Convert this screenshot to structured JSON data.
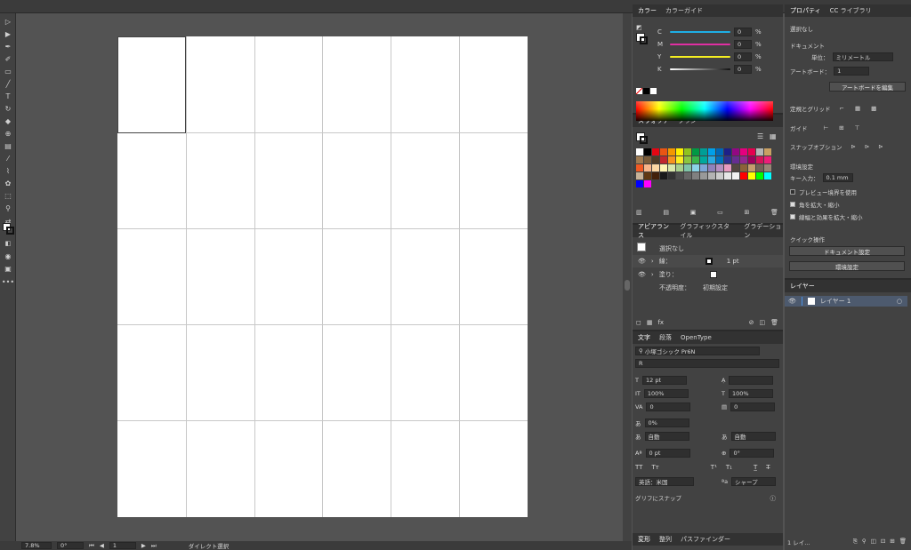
{
  "color_panel": {
    "tabs": [
      "カラー",
      "カラーガイド"
    ],
    "channels": [
      {
        "label": "C",
        "value": "0",
        "unit": "%",
        "color": "#1eaee5"
      },
      {
        "label": "M",
        "value": "0",
        "unit": "%",
        "color": "#e02fa2"
      },
      {
        "label": "Y",
        "value": "0",
        "unit": "%",
        "color": "#f4ee21"
      },
      {
        "label": "K",
        "value": "0",
        "unit": "%",
        "color": "#1b1b1b"
      }
    ]
  },
  "swatches_panel": {
    "tabs": [
      "スウォッチ",
      "ブラシ"
    ],
    "colors": [
      "#ffffff",
      "#000000",
      "#e30613",
      "#e95513",
      "#f39800",
      "#fff100",
      "#8fc31f",
      "#009944",
      "#009e96",
      "#00a0e9",
      "#0068b7",
      "#1d2088",
      "#920783",
      "#e4007f",
      "#e5004f",
      "#b5b5b6",
      "#c9a063",
      "#a07c52",
      "#7a5c3a",
      "#4d3b26",
      "#c1272d",
      "#f7931e",
      "#fcee21",
      "#8cc63f",
      "#39b54a",
      "#00a99d",
      "#29abe2",
      "#0071bc",
      "#2e3192",
      "#662d91",
      "#93278f",
      "#9e005d",
      "#d4145a",
      "#ed1e79",
      "#f15a24",
      "#f7b58a",
      "#fbd7a3",
      "#fff6b3",
      "#d9e8a9",
      "#a7d08c",
      "#7fc4a8",
      "#8bd3e6",
      "#7ea7d8",
      "#8f82bc",
      "#b58fc1",
      "#e89ac0",
      "#534741",
      "#8c6239",
      "#c69c6d",
      "#736357",
      "#998675",
      "#c7b299",
      "#603813",
      "#42210b",
      "#1a1a1a",
      "#333333",
      "#4d4d4d",
      "#666666",
      "#808080",
      "#999999",
      "#b3b3b3",
      "#cccccc",
      "#e6e6e6",
      "#f2f2f2",
      "#ff0000",
      "#ffff00",
      "#00ff00",
      "#00ffff",
      "#0000ff",
      "#ff00ff"
    ]
  },
  "appearance_panel": {
    "tabs": [
      "アピアランス",
      "グラフィックスタイル",
      "グラデーション"
    ],
    "title": "選択なし",
    "stroke_label": "線：",
    "stroke_value": "1 pt",
    "fill_label": "塗り：",
    "opacity_label": "不透明度：",
    "opacity_value": "初期設定"
  },
  "character_panel": {
    "tabs": [
      "文字",
      "段落",
      "OpenType"
    ],
    "font_family": "小塚ゴシック Pr6N",
    "font_style": "R",
    "font_size": "12 pt",
    "leading": "",
    "vertical_scale": "100%",
    "horizontal_scale": "100%",
    "kerning": "0",
    "tracking": "0",
    "tsume": "0%",
    "aki_left": "自動",
    "aki_right": "自動",
    "baseline": "0 pt",
    "rotation": "0°",
    "language": "英語：米国",
    "antialias": "シャープ",
    "glyph_snap": "グリフにスナップ"
  },
  "bottom_panel": {
    "tabs": [
      "変形",
      "整列",
      "パスファインダー"
    ]
  },
  "properties_panel": {
    "tabs": [
      "プロパティ",
      "CC ライブラリ"
    ],
    "selection": "選択なし",
    "document_title": "ドキュメント",
    "unit_label": "単位：",
    "unit_value": "ミリメートル",
    "artboard_label": "アートボード：",
    "artboard_value": "1",
    "edit_artboard_button": "アートボードを編集",
    "rulers_grids_label": "定規とグリッド",
    "guides_label": "ガイド",
    "snap_label": "スナップオプション",
    "prefs_title": "環境設定",
    "key_input_label": "キー入力：",
    "key_input_value": "0.1 mm",
    "checkboxes": [
      {
        "label": "プレビュー境界を使用",
        "checked": false
      },
      {
        "label": "角を拡大・縮小",
        "checked": true
      },
      {
        "label": "線幅と効果を拡大・縮小",
        "checked": true
      }
    ],
    "quick_actions_title": "クイック操作",
    "document_settings_button": "ドキュメント設定",
    "preferences_button": "環境設定"
  },
  "layers_panel": {
    "tab": "レイヤー",
    "layer_name": "レイヤー 1",
    "footer_count": "1 レイ..."
  },
  "statusbar": {
    "zoom": "7.8%",
    "rotation": "0°",
    "artboard": "1",
    "tool": "ダイレクト選択"
  }
}
